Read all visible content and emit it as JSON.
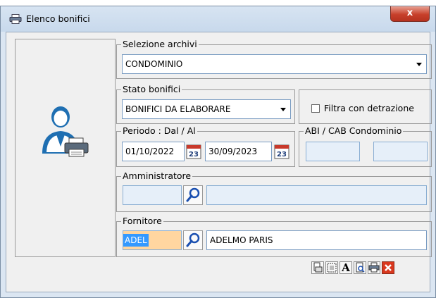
{
  "window": {
    "title": "Elenco bonifici",
    "close_label": "x"
  },
  "selezione_archivi": {
    "legend": "Selezione archivi",
    "value": "CONDOMINIO"
  },
  "stato_bonifici": {
    "legend": "Stato bonifici",
    "value": "BONIFICI DA ELABORARE"
  },
  "filtra": {
    "label": "Filtra con detrazione",
    "checked": false
  },
  "periodo": {
    "legend": "Periodo : Dal / Al",
    "dal": "01/10/2022",
    "al": "30/09/2023",
    "cal_day": "23"
  },
  "abi_cab": {
    "legend": "ABI / CAB Condominio",
    "abi": "",
    "cab": ""
  },
  "amministratore": {
    "legend": "Amministratore",
    "code": "",
    "name": ""
  },
  "fornitore": {
    "legend": "Fornitore",
    "code": "ADEL",
    "name": "ADELMO PARIS"
  },
  "toolbar": {
    "icons": [
      "export-icon",
      "select-frame-icon",
      "font-icon",
      "print-preview-icon",
      "print-icon",
      "close-icon"
    ],
    "font_label": "A"
  },
  "colors": {
    "accent": "#3399ff",
    "field_highlight": "#ffd6a0",
    "close_red": "#d9381e"
  }
}
